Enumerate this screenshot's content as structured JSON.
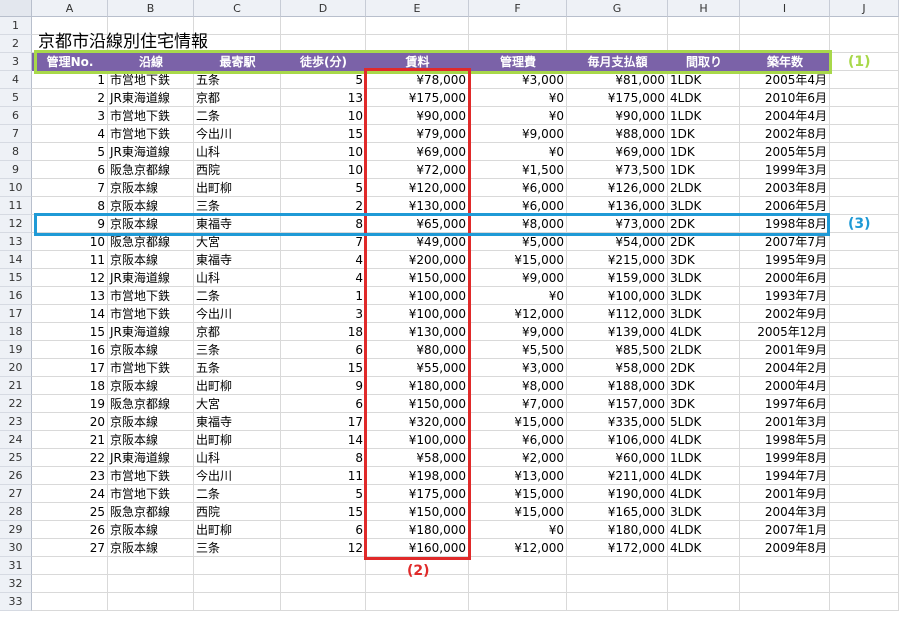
{
  "title": "京都市沿線別住宅情報",
  "columns": [
    "A",
    "B",
    "C",
    "D",
    "E",
    "F",
    "G",
    "H",
    "I",
    "J"
  ],
  "rows": [
    "1",
    "2",
    "3",
    "4",
    "5",
    "6",
    "7",
    "8",
    "9",
    "10",
    "11",
    "12",
    "13",
    "14",
    "15",
    "16",
    "17",
    "18",
    "19",
    "20",
    "21",
    "22",
    "23",
    "24",
    "25",
    "26",
    "27",
    "28",
    "29",
    "30",
    "31",
    "32",
    "33"
  ],
  "headers": [
    "管理No.",
    "沿線",
    "最寄駅",
    "徒歩(分)",
    "賃料",
    "管理費",
    "毎月支払額",
    "間取り",
    "築年数"
  ],
  "data": [
    [
      "1",
      "市営地下鉄",
      "五条",
      "5",
      "¥78,000",
      "¥3,000",
      "¥81,000",
      "1LDK",
      "2005年4月"
    ],
    [
      "2",
      "JR東海道線",
      "京都",
      "13",
      "¥175,000",
      "¥0",
      "¥175,000",
      "4LDK",
      "2010年6月"
    ],
    [
      "3",
      "市営地下鉄",
      "二条",
      "10",
      "¥90,000",
      "¥0",
      "¥90,000",
      "1LDK",
      "2004年4月"
    ],
    [
      "4",
      "市営地下鉄",
      "今出川",
      "15",
      "¥79,000",
      "¥9,000",
      "¥88,000",
      "1DK",
      "2002年8月"
    ],
    [
      "5",
      "JR東海道線",
      "山科",
      "10",
      "¥69,000",
      "¥0",
      "¥69,000",
      "1DK",
      "2005年5月"
    ],
    [
      "6",
      "阪急京都線",
      "西院",
      "10",
      "¥72,000",
      "¥1,500",
      "¥73,500",
      "1DK",
      "1999年3月"
    ],
    [
      "7",
      "京阪本線",
      "出町柳",
      "5",
      "¥120,000",
      "¥6,000",
      "¥126,000",
      "2LDK",
      "2003年8月"
    ],
    [
      "8",
      "京阪本線",
      "三条",
      "2",
      "¥130,000",
      "¥6,000",
      "¥136,000",
      "3LDK",
      "2006年5月"
    ],
    [
      "9",
      "京阪本線",
      "東福寺",
      "8",
      "¥65,000",
      "¥8,000",
      "¥73,000",
      "2DK",
      "1998年8月"
    ],
    [
      "10",
      "阪急京都線",
      "大宮",
      "7",
      "¥49,000",
      "¥5,000",
      "¥54,000",
      "2DK",
      "2007年7月"
    ],
    [
      "11",
      "京阪本線",
      "東福寺",
      "4",
      "¥200,000",
      "¥15,000",
      "¥215,000",
      "3DK",
      "1995年9月"
    ],
    [
      "12",
      "JR東海道線",
      "山科",
      "4",
      "¥150,000",
      "¥9,000",
      "¥159,000",
      "3LDK",
      "2000年6月"
    ],
    [
      "13",
      "市営地下鉄",
      "二条",
      "1",
      "¥100,000",
      "¥0",
      "¥100,000",
      "3LDK",
      "1993年7月"
    ],
    [
      "14",
      "市営地下鉄",
      "今出川",
      "3",
      "¥100,000",
      "¥12,000",
      "¥112,000",
      "3LDK",
      "2002年9月"
    ],
    [
      "15",
      "JR東海道線",
      "京都",
      "18",
      "¥130,000",
      "¥9,000",
      "¥139,000",
      "4LDK",
      "2005年12月"
    ],
    [
      "16",
      "京阪本線",
      "三条",
      "6",
      "¥80,000",
      "¥5,500",
      "¥85,500",
      "2LDK",
      "2001年9月"
    ],
    [
      "17",
      "市営地下鉄",
      "五条",
      "15",
      "¥55,000",
      "¥3,000",
      "¥58,000",
      "2DK",
      "2004年2月"
    ],
    [
      "18",
      "京阪本線",
      "出町柳",
      "9",
      "¥180,000",
      "¥8,000",
      "¥188,000",
      "3DK",
      "2000年4月"
    ],
    [
      "19",
      "阪急京都線",
      "大宮",
      "6",
      "¥150,000",
      "¥7,000",
      "¥157,000",
      "3DK",
      "1997年6月"
    ],
    [
      "20",
      "京阪本線",
      "東福寺",
      "17",
      "¥320,000",
      "¥15,000",
      "¥335,000",
      "5LDK",
      "2001年3月"
    ],
    [
      "21",
      "京阪本線",
      "出町柳",
      "14",
      "¥100,000",
      "¥6,000",
      "¥106,000",
      "4LDK",
      "1998年5月"
    ],
    [
      "22",
      "JR東海道線",
      "山科",
      "8",
      "¥58,000",
      "¥2,000",
      "¥60,000",
      "1LDK",
      "1999年8月"
    ],
    [
      "23",
      "市営地下鉄",
      "今出川",
      "11",
      "¥198,000",
      "¥13,000",
      "¥211,000",
      "4LDK",
      "1994年7月"
    ],
    [
      "24",
      "市営地下鉄",
      "二条",
      "5",
      "¥175,000",
      "¥15,000",
      "¥190,000",
      "4LDK",
      "2001年9月"
    ],
    [
      "25",
      "阪急京都線",
      "西院",
      "15",
      "¥150,000",
      "¥15,000",
      "¥165,000",
      "3LDK",
      "2004年3月"
    ],
    [
      "26",
      "京阪本線",
      "出町柳",
      "6",
      "¥180,000",
      "¥0",
      "¥180,000",
      "4LDK",
      "2007年1月"
    ],
    [
      "27",
      "京阪本線",
      "三条",
      "12",
      "¥160,000",
      "¥12,000",
      "¥172,000",
      "4LDK",
      "2009年8月"
    ]
  ],
  "annotations": {
    "label1": "(1)",
    "label2": "(2)",
    "label3": "(3)",
    "color1": "#a8d84a",
    "color2": "#e02a2a",
    "color3": "#1f9ad6"
  },
  "colors": {
    "header_bg": "#7b62a8",
    "header_text": "#ffffff"
  }
}
